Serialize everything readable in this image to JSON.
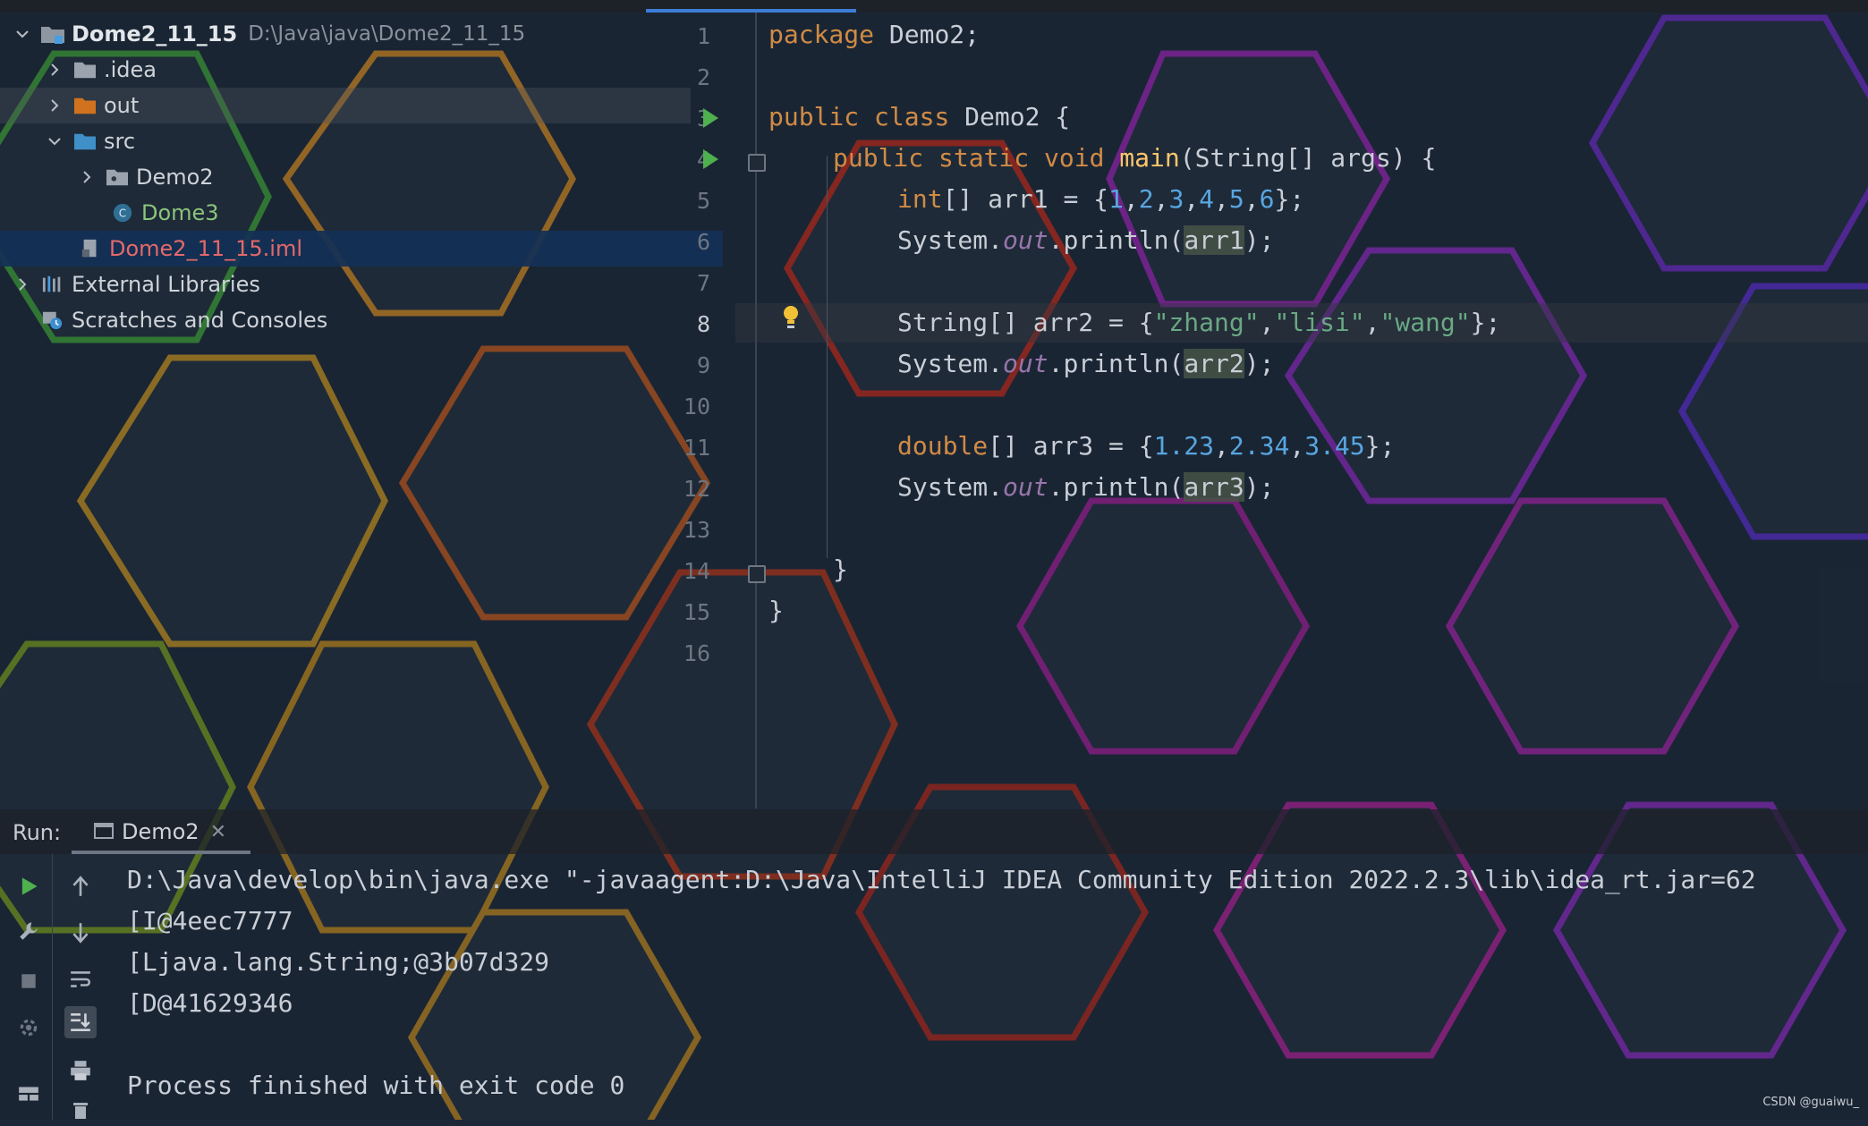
{
  "project_tree": {
    "root": {
      "name": "Dome2_11_15",
      "path": "D:\\Java\\java\\Dome2_11_15"
    },
    "items": [
      {
        "label": ".idea"
      },
      {
        "label": "out"
      },
      {
        "label": "src"
      },
      {
        "label": "Demo2"
      },
      {
        "label": "Dome3"
      },
      {
        "label": "Dome2_11_15.iml"
      },
      {
        "label": "External Libraries"
      },
      {
        "label": "Scratches and Consoles"
      }
    ]
  },
  "editor": {
    "current_line": 8,
    "line_numbers": [
      "1",
      "2",
      "3",
      "4",
      "5",
      "6",
      "7",
      "8",
      "9",
      "10",
      "11",
      "12",
      "13",
      "14",
      "15",
      "16"
    ],
    "code": {
      "l1_kw": "package",
      "l1_rest": " Demo2;",
      "l3_kw": "public class",
      "l3_rest": " Demo2 {",
      "l4_kw": "public static void",
      "l4_fn": "main",
      "l4_rest": "(String[] args) {",
      "l5_kw": "int",
      "l5_a": "[] arr1 = {",
      "l5_nums": [
        "1",
        "2",
        "3",
        "4",
        "5",
        "6"
      ],
      "l5_end": "};",
      "l6_a": "System.",
      "l6_out": "out",
      "l6_b": ".println(",
      "l6_var": "arr1",
      "l6_end": ");",
      "l8_a": "String[] arr2 = {",
      "l8_s1": "\"zhang\"",
      "l8_s2": "\"lisi\"",
      "l8_s3": "\"wang\"",
      "l8_end": "};",
      "l9_a": "System.",
      "l9_out": "out",
      "l9_b": ".println(",
      "l9_var": "arr2",
      "l9_end": ");",
      "l11_kw": "double",
      "l11_a": "[] arr3 = {",
      "l11_nums": [
        "1.23",
        "2.34",
        "3.45"
      ],
      "l11_end": "};",
      "l12_a": "System.",
      "l12_out": "out",
      "l12_b": ".println(",
      "l12_var": "arr3",
      "l12_end": ");",
      "l14": "}",
      "l15": "}"
    }
  },
  "run_panel": {
    "label": "Run:",
    "tab": "Demo2",
    "console_lines": [
      "D:\\Java\\develop\\bin\\java.exe \"-javaagent:D:\\Java\\IntelliJ IDEA Community Edition 2022.2.3\\lib\\idea_rt.jar=62",
      "[I@4eec7777",
      "[Ljava.lang.String;@3b07d329",
      "[D@41629346",
      "",
      "Process finished with exit code 0"
    ]
  },
  "watermark": "CSDN @guaiwu_",
  "colors": {
    "keyword": "#d08b45",
    "number": "#58a6e0",
    "string": "#6aa884",
    "selection": "#123056"
  }
}
